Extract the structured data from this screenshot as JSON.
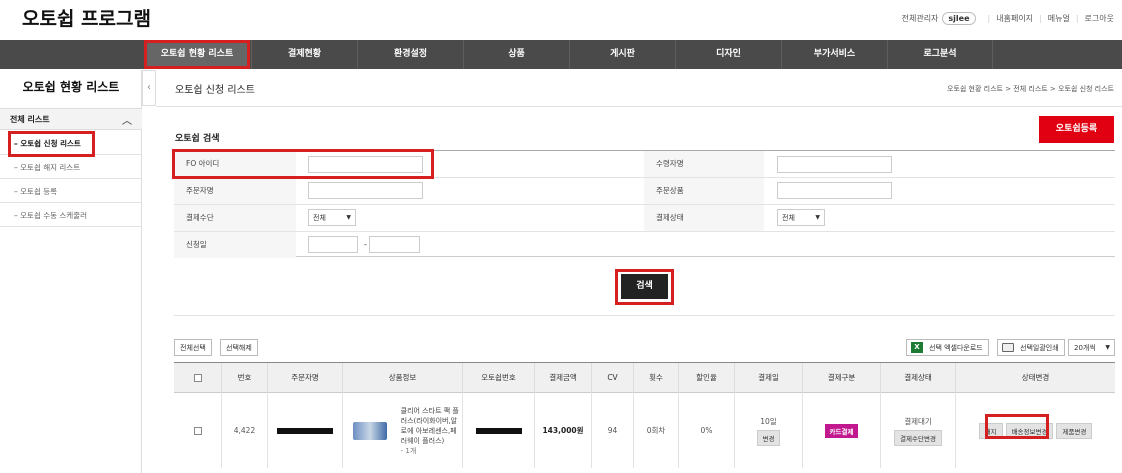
{
  "app": {
    "title": "오토쉽 프로그램"
  },
  "topbar": {
    "role": "전체관리자",
    "user": "sjlee",
    "links": [
      "내홈페이지",
      "메뉴얼",
      "로그아웃"
    ]
  },
  "nav": {
    "items": [
      "오토쉽 현황 리스트",
      "결제현황",
      "환경설정",
      "상품",
      "게시판",
      "디자인",
      "부가서비스",
      "로그분석"
    ]
  },
  "sidebar": {
    "title": "오토쉽 현황 리스트",
    "section": "전체 리스트",
    "items": [
      "오토쉽 신청 리스트",
      "오토쉽 해지 리스트",
      "오토쉽 등록",
      "오토쉽 수동 스케줄러"
    ]
  },
  "page": {
    "title": "오토쉽 신청 리스트",
    "breadcrumb": "오토쉽 현황 리스트 > 전체 리스트 > 오토쉽 신청 리스트",
    "register_button": "오토쉽등록"
  },
  "search": {
    "title": "오토쉽 검색",
    "fo_id_label": "FO 아이디",
    "recipient_label": "수령자명",
    "orderer_label": "주문자명",
    "product_label": "주문상품",
    "payment_method_label": "결제수단",
    "payment_method_value": "전체",
    "payment_status_label": "결제상태",
    "payment_status_value": "전체",
    "apply_date_label": "신청일",
    "date_separator": "-",
    "search_button": "검색"
  },
  "list": {
    "select_all": "전체선택",
    "deselect": "선택해제",
    "excel_download": "선택 엑셀다운로드",
    "print_selected": "선택일괄인쇄",
    "page_size": "20개씩",
    "columns": [
      "번호",
      "주문자명",
      "상품정보",
      "오토쉽번호",
      "결제금액",
      "CV",
      "횟수",
      "할인율",
      "결제일",
      "결제구분",
      "결제상태",
      "상태변경"
    ],
    "rows": [
      {
        "no": "4,422",
        "product_name": "클리어 스타트 팩 플러스(라이화이버,알로에 아보레센스,페러웨이 플러스)",
        "product_qty": "- 1개",
        "amount": "143,000원",
        "cv": "94",
        "count": "0회차",
        "discount": "0%",
        "pay_day": "10일",
        "pay_day_change": "변경",
        "pay_type": "카드결제",
        "pay_status": "결제대기",
        "pay_method_change": "결제수단변경",
        "actions": [
          "해지",
          "배송정보변경",
          "제품변경"
        ]
      }
    ]
  },
  "colors": {
    "nav_bg": "#4a4a4a",
    "accent_red": "#e00012",
    "highlight_red": "#d42020",
    "badge_magenta": "#c2188f"
  }
}
